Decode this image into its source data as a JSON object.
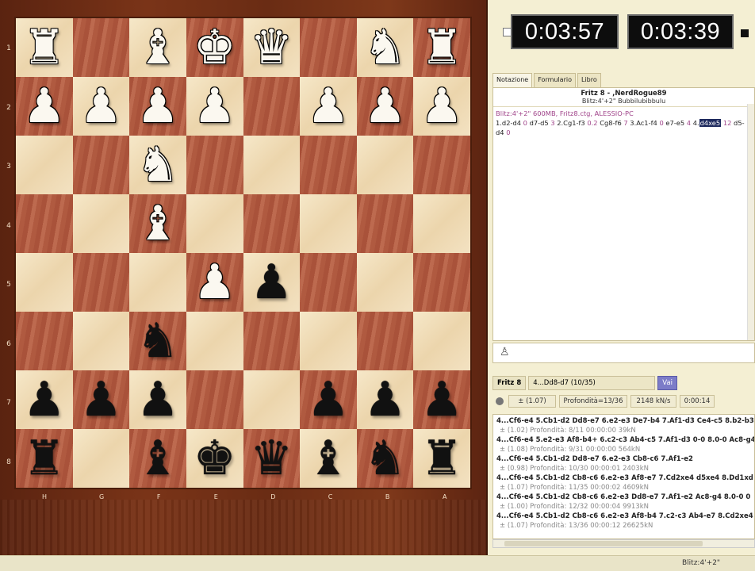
{
  "clocks": {
    "left": "0:03:57",
    "right": "0:03:39"
  },
  "tabs": [
    "Notazione",
    "Formulario",
    "Libro"
  ],
  "notation": {
    "title": "Fritz 8 - ,NerdRogue89",
    "subtitle": "Blitz:4'+2\" Bubbilubibbulu",
    "info": "Blitz:4'+2\"  600MB, Fritz8.ctg, ALESSIO-PC",
    "moves": [
      {
        "n": "1.",
        "m": "d2-d4",
        "t": "0"
      },
      {
        "m": "d7-d5",
        "t": "3"
      },
      {
        "n": "2.",
        "m": "Cg1-f3",
        "t": "0.2"
      },
      {
        "m": "Cg8-f6",
        "t": "7"
      },
      {
        "n": "3.",
        "m": "Ac1-f4",
        "t": "0"
      },
      {
        "m": "e7-e5",
        "t": "4"
      },
      {
        "n": "4.",
        "m": "d4xe5",
        "t": "12",
        "hl": true
      },
      {
        "m": "d5-d4",
        "t": "0"
      }
    ]
  },
  "engine": {
    "name": "Fritz 8",
    "current": "4...Dd8-d7 (10/35)",
    "go_label": "Vai",
    "eval": "± (1.07)",
    "depth": "Profondità=13/36",
    "speed": "2148 kN/s",
    "time": "0:00:14",
    "lines": [
      {
        "moves": "4...Cf6-e4 5.Cb1-d2 Dd8-e7 6.e2-e3 De7-b4 7.Af1-d3 Ce4-c5 8.b2-b3",
        "info": "± (1.02)  Profondità: 8/11  00:00:00  39kN"
      },
      {
        "moves": "4...Cf6-e4 5.e2-e3 Af8-b4+ 6.c2-c3 Ab4-c5 7.Af1-d3 0-0 8.0-0 Ac8-g4",
        "info": "± (1.08)  Profondità: 9/31  00:00:00  564kN"
      },
      {
        "moves": "4...Cf6-e4 5.Cb1-d2 Dd8-e7 6.e2-e3 Cb8-c6 7.Af1-e2",
        "info": "± (0.98)  Profondità: 10/30  00:00:01  2403kN"
      },
      {
        "moves": "4...Cf6-e4 5.Cb1-d2 Cb8-c6 6.e2-e3 Af8-e7 7.Cd2xe4 d5xe4 8.Dd1xd",
        "info": "± (1.07)  Profondità: 11/35  00:00:02  4609kN"
      },
      {
        "moves": "4...Cf6-e4 5.Cb1-d2 Cb8-c6 6.e2-e3 Dd8-e7 7.Af1-e2 Ac8-g4 8.0-0 0",
        "info": "± (1.00)  Profondità: 12/32  00:00:04  9913kN"
      },
      {
        "moves": "4...Cf6-e4 5.Cb1-d2 Cb8-c6 6.e2-e3 Af8-b4 7.c2-c3 Ab4-e7 8.Cd2xe4",
        "info": "± (1.07)  Profondità: 13/36  00:00:12  26625kN"
      }
    ]
  },
  "status": "Blitz:4'+2\"",
  "board": {
    "ranks": [
      "1",
      "2",
      "3",
      "4",
      "5",
      "6",
      "7",
      "8"
    ],
    "files": [
      "H",
      "G",
      "F",
      "E",
      "D",
      "C",
      "B",
      "A"
    ],
    "rows": [
      [
        "wR",
        "",
        "wB",
        "wK",
        "wQ",
        "",
        "wN",
        "wR"
      ],
      [
        "wP",
        "wP",
        "wP",
        "wP",
        "",
        "wP",
        "wP",
        "wP"
      ],
      [
        "",
        "",
        "wN",
        "",
        "",
        "",
        "",
        ""
      ],
      [
        "",
        "",
        "wB",
        "",
        "",
        "",
        "",
        ""
      ],
      [
        "",
        "",
        "",
        "wP",
        "bP",
        "",
        "",
        ""
      ],
      [
        "",
        "",
        "bN",
        "",
        "",
        "",
        "",
        ""
      ],
      [
        "bP",
        "bP",
        "bP",
        "",
        "",
        "bP",
        "bP",
        "bP"
      ],
      [
        "bR",
        "",
        "bB",
        "bK",
        "bQ",
        "bB",
        "bN",
        "bR"
      ]
    ]
  },
  "colors": {
    "accent": "#1e2a5e",
    "go_button": "#7c7cc8",
    "dark_square": "#b25d44",
    "light_square": "#f1dfbd"
  }
}
